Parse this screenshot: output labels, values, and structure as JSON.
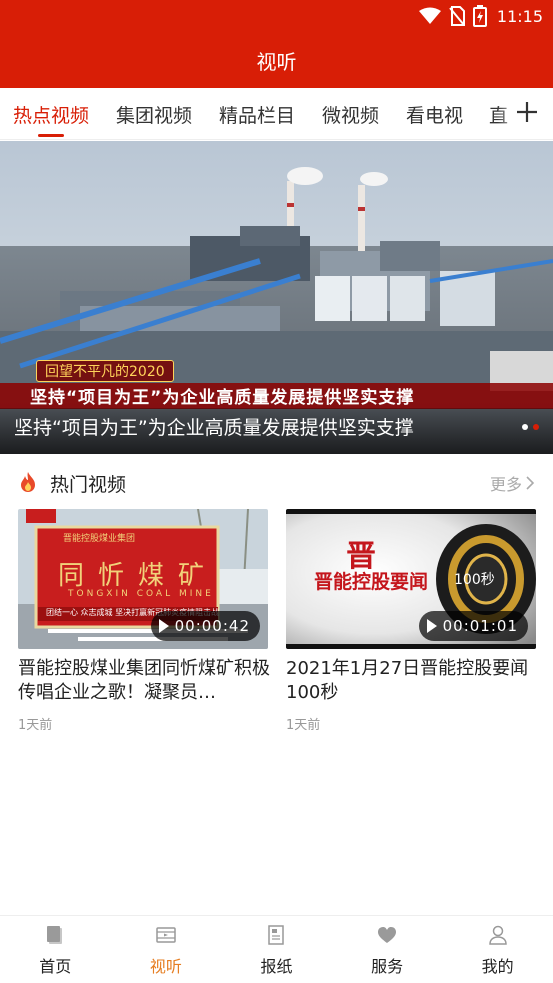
{
  "status_bar": {
    "time": "11:15"
  },
  "header": {
    "title": "视听"
  },
  "tabs": [
    {
      "label": "热点视频",
      "active": true
    },
    {
      "label": "集团视频",
      "active": false
    },
    {
      "label": "精品栏目",
      "active": false
    },
    {
      "label": "微视频",
      "active": false
    },
    {
      "label": "看电视",
      "active": false
    },
    {
      "label": "直",
      "active": false
    }
  ],
  "banner": {
    "tag": "回望不平凡的2020",
    "overlay": "坚持“项目为王”为企业高质量发展提供坚实支撑",
    "caption": "坚持“项目为王”为企业高质量发展提供坚实支撑",
    "slide_count": 2,
    "active_slide": 2
  },
  "hot_section": {
    "title": "热门视频",
    "more": "更多"
  },
  "videos": [
    {
      "title": "晋能控股煤业集团同忻煤矿积极传唱企业之歌！凝聚员…",
      "duration": "00:00:42",
      "time": "1天前",
      "thumb_sign": "同忻煤矿",
      "thumb_sign_en": "TONGXIN COAL MINE",
      "thumb_top": "晋能控股煤业集团",
      "thumb_banner": "团结一心  众志成城  坚决打赢新冠肺炎疫情阻击战"
    },
    {
      "title": "2021年1月27日晋能控股要闻100秒",
      "duration": "00:01:01",
      "time": "1天前",
      "thumb_logo": "晋",
      "thumb_text": "晋能控股要闻",
      "thumb_suffix": "100秒"
    }
  ],
  "bottom_nav": [
    {
      "label": "首页",
      "icon": "home-icon",
      "active": false
    },
    {
      "label": "视听",
      "icon": "video-icon",
      "active": true
    },
    {
      "label": "报纸",
      "icon": "newspaper-icon",
      "active": false
    },
    {
      "label": "服务",
      "icon": "heart-icon",
      "active": false
    },
    {
      "label": "我的",
      "icon": "user-icon",
      "active": false
    }
  ],
  "colors": {
    "brand": "#d81e06",
    "active_nav": "#e67e22"
  }
}
